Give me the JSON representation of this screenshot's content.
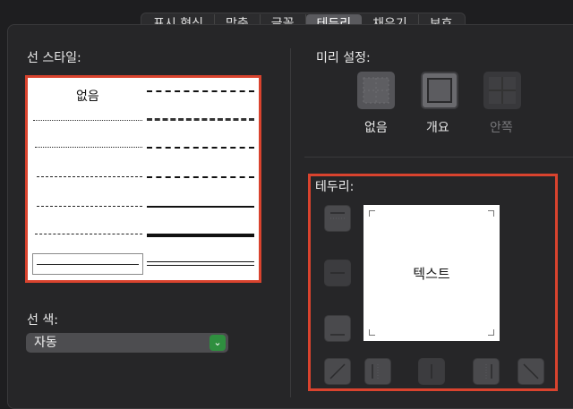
{
  "tabs": [
    {
      "label": "표시 형식",
      "active": false
    },
    {
      "label": "맞춤",
      "active": false
    },
    {
      "label": "글꼴",
      "active": false
    },
    {
      "label": "테두리",
      "active": true
    },
    {
      "label": "채우기",
      "active": false
    },
    {
      "label": "보호",
      "active": false
    }
  ],
  "line_style": {
    "label": "선 스타일:",
    "none_option": "없음"
  },
  "line_color": {
    "label": "선 색:",
    "value": "자동"
  },
  "presets": {
    "label": "미리 설정:",
    "items": [
      {
        "label": "없음",
        "enabled": true
      },
      {
        "label": "개요",
        "enabled": true
      },
      {
        "label": "안쪽",
        "enabled": false
      }
    ]
  },
  "border": {
    "label": "테두리:",
    "preview_text": "텍스트"
  },
  "colors": {
    "highlight": "#d9432e",
    "dropdown_accent": "#2f8f3f"
  }
}
